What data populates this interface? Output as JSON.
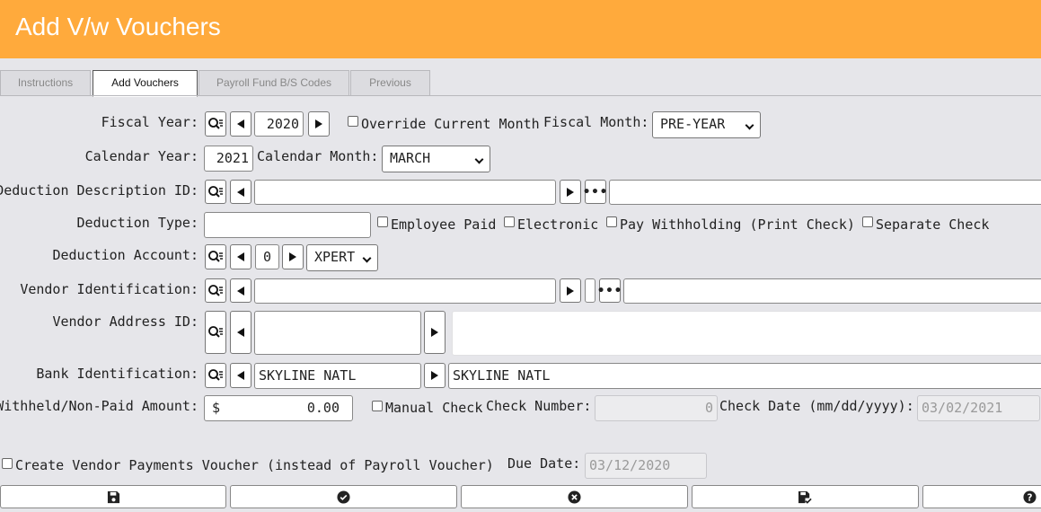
{
  "title": "Add V/w Vouchers",
  "tabs": [
    "Instructions",
    "Add Vouchers",
    "Payroll Fund B/S Codes",
    "Previous"
  ],
  "fiscal_year": {
    "label": "Fiscal Year:",
    "value": "2020"
  },
  "override": {
    "label": "Override Current Month",
    "checked": false
  },
  "fiscal_month": {
    "label": "Fiscal Month:",
    "value": "PRE-YEAR"
  },
  "calendar_year": {
    "label": "Calendar Year:",
    "value": "2021"
  },
  "calendar_month": {
    "label": "Calendar Month:",
    "value": "MARCH"
  },
  "deduction_description": {
    "label": "Deduction Description ID:",
    "value": "",
    "description": ""
  },
  "deduction_type": {
    "label": "Deduction Type:",
    "value": "",
    "employee_paid": "Employee Paid",
    "electronic": "Electronic",
    "pay_withholding": "Pay Withholding (Print Check)",
    "separate_check": "Separate Check"
  },
  "deduction_account": {
    "label": "Deduction Account:",
    "value": "0",
    "system": "XPERT"
  },
  "vendor_identification": {
    "label": "Vendor Identification:",
    "value": "",
    "name": ""
  },
  "vendor_address": {
    "label": "Vendor Address ID:",
    "value": "",
    "address": ""
  },
  "bank_identification": {
    "label": "Bank Identification:",
    "value": "SKYLINE NATL",
    "name": "SKYLINE NATL"
  },
  "withheld": {
    "label": "Withheld/Non-Paid Amount:",
    "currency": "$",
    "value": "0.00"
  },
  "manual_check": {
    "label": "Manual Check"
  },
  "check_number": {
    "label": "Check Number:",
    "value": "0"
  },
  "check_date": {
    "label": "Check Date (mm/dd/yyyy):",
    "value": "03/02/2021"
  },
  "create_vendor": {
    "label": "Create Vendor Payments Voucher (instead of Payroll Voucher)"
  },
  "due_date": {
    "label": "Due Date:",
    "value": "03/12/2020"
  },
  "footer_buttons": [
    "save-icon",
    "check-circle-icon",
    "cancel-circle-icon",
    "save-check-icon",
    "help-circle-icon"
  ]
}
